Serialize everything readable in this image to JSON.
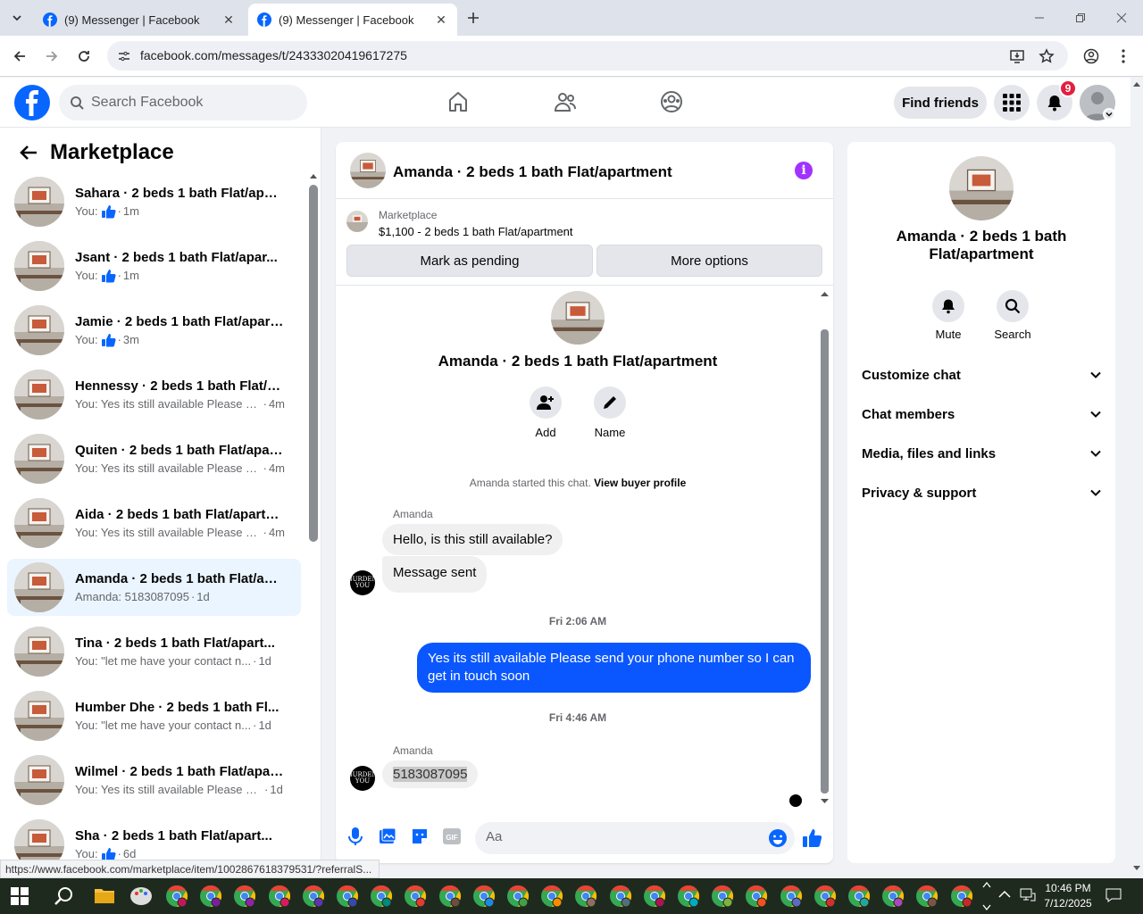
{
  "browser": {
    "tabs": [
      {
        "title": "(9) Messenger | Facebook",
        "active": false
      },
      {
        "title": "(9) Messenger | Facebook",
        "active": true
      }
    ],
    "url": "facebook.com/messages/t/24333020419617275"
  },
  "fb_header": {
    "search_placeholder": "Search Facebook",
    "find_friends": "Find friends",
    "notification_count": "9"
  },
  "left_panel": {
    "title": "Marketplace",
    "conversations": [
      {
        "name": "Sahara · 2 beds 1 bath Flat/apart...",
        "preview": "You:",
        "like": true,
        "time": "1m"
      },
      {
        "name": "Jsant · 2 beds 1 bath Flat/apar...",
        "preview": "You:",
        "like": true,
        "time": "1m"
      },
      {
        "name": "Jamie · 2 beds 1 bath Flat/apart...",
        "preview": "You:",
        "like": true,
        "time": "3m"
      },
      {
        "name": "Hennessy · 2 beds 1 bath Flat/ap...",
        "preview": "You: Yes its still available Please se...",
        "like": false,
        "time": "4m"
      },
      {
        "name": "Quiten · 2 beds 1 bath Flat/apart...",
        "preview": "You: Yes its still available Please se...",
        "like": false,
        "time": "4m"
      },
      {
        "name": "Aida · 2 beds 1 bath Flat/apartm...",
        "preview": "You: Yes its still available Please se...",
        "like": false,
        "time": "4m"
      },
      {
        "name": "Amanda · 2 beds 1 bath Flat/apa...",
        "preview": "Amanda: 5183087095",
        "like": false,
        "time": "1d"
      },
      {
        "name": "Tina · 2 beds 1 bath Flat/apart...",
        "preview": "You: \"let me have your contact n...",
        "like": false,
        "time": "1d"
      },
      {
        "name": "Humber Dhe · 2 beds 1 bath Fl...",
        "preview": "You: \"let me have your contact n...",
        "like": false,
        "time": "1d"
      },
      {
        "name": "Wilmel · 2 beds 1 bath Flat/apart...",
        "preview": "You: Yes its still available Please sen...",
        "like": false,
        "time": "1d"
      },
      {
        "name": "Sha · 2 beds 1 bath Flat/apart...",
        "preview": "You:",
        "like": true,
        "time": "6d"
      }
    ]
  },
  "chat": {
    "header_name": "Amanda · 2 beds 1 bath Flat/apartment",
    "marketplace_label": "Marketplace",
    "listing": "$1,100 - 2 beds 1 bath Flat/apartment",
    "mark_pending": "Mark as pending",
    "more_options": "More options",
    "intro_name": "Amanda · 2 beds 1 bath Flat/apartment",
    "add_label": "Add",
    "name_label": "Name",
    "started_text": "Amanda started this chat.",
    "buyer_profile": "View buyer profile",
    "sender1": "Amanda",
    "msg1": "Hello, is this still available?",
    "msg2": "Message sent",
    "time1": "Fri 2:06 AM",
    "msg_out": "Yes its still available Please send your phone number so I can get in touch soon",
    "time2": "Fri 4:46 AM",
    "sender2": "Amanda",
    "msg3": "5183087095",
    "avatar_text": "BURDEN YOU",
    "composer_placeholder": "Aa"
  },
  "right_panel": {
    "name": "Amanda · 2 beds 1 bath Flat/apartment",
    "mute": "Mute",
    "search": "Search",
    "sections": [
      "Customize chat",
      "Chat members",
      "Media, files and links",
      "Privacy & support"
    ]
  },
  "status_url": "https://www.facebook.com/marketplace/item/1002867618379531/?referralS...",
  "taskbar": {
    "time": "10:46 PM",
    "date": "7/12/2025"
  },
  "colors": {
    "fb_blue": "#0866ff",
    "bubble_out": "#0a57ff",
    "info": "#a033ff",
    "badge": "#e41e3f"
  }
}
